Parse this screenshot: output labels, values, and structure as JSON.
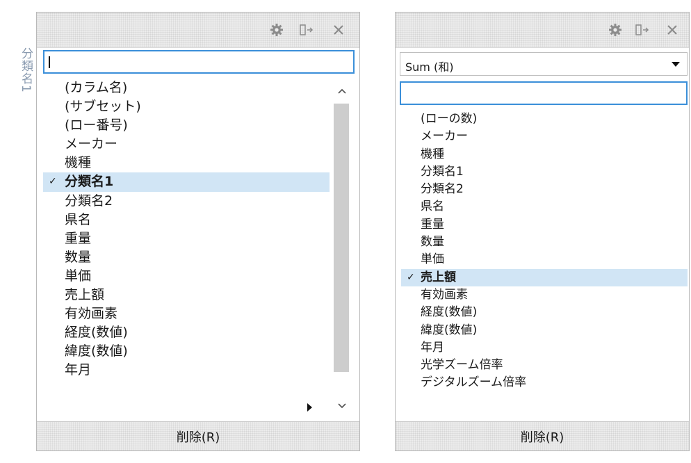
{
  "side_label": "分類名1",
  "colors": {
    "accent": "#3b8fd9",
    "selection": "#d1e5f5",
    "icon": "#8c8c8c"
  },
  "icons": [
    "gear-icon",
    "pop-out-icon",
    "close-icon"
  ],
  "panel1": {
    "search": {
      "value": ""
    },
    "items": [
      "(カラム名)",
      "(サブセット)",
      "(ロー番号)",
      "メーカー",
      "機種",
      "分類名1",
      "分類名2",
      "県名",
      "重量",
      "数量",
      "単価",
      "売上額",
      "有効画素",
      "経度(数値)",
      "緯度(数値)",
      "年月"
    ],
    "selected": "分類名1",
    "check": "✓",
    "footer_button": "削除(R)"
  },
  "panel2": {
    "dropdown": {
      "selected": "Sum (和)"
    },
    "search": {
      "value": ""
    },
    "items": [
      "(ローの数)",
      "メーカー",
      "機種",
      "分類名1",
      "分類名2",
      "県名",
      "重量",
      "数量",
      "単価",
      "売上額",
      "有効画素",
      "経度(数値)",
      "緯度(数値)",
      "年月",
      "光学ズーム倍率",
      "デジタルズーム倍率"
    ],
    "selected": "売上額",
    "check": "✓",
    "footer_button": "削除(R)"
  }
}
